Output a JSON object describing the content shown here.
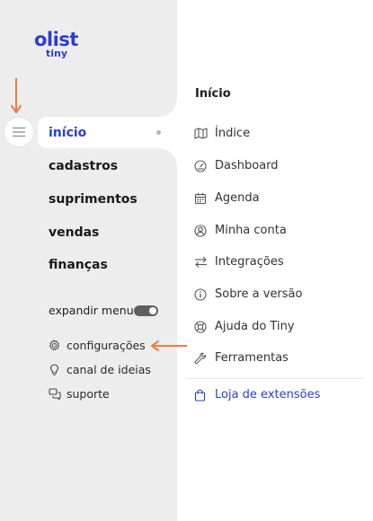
{
  "brand": {
    "name": "olist",
    "sub": "tiny",
    "color": "#2b3ed4"
  },
  "sidebar": {
    "menu_button_icon": "hamburger-icon",
    "items": [
      {
        "label": "início",
        "active": true
      },
      {
        "label": "cadastros"
      },
      {
        "label": "suprimentos"
      },
      {
        "label": "vendas"
      },
      {
        "label": "finanças"
      }
    ],
    "expand_label": "expandir menu",
    "expand_toggle_on": true,
    "utilities": [
      {
        "label": "configurações",
        "icon": "gear-icon"
      },
      {
        "label": "canal de ideias",
        "icon": "lightbulb-icon"
      },
      {
        "label": "suporte",
        "icon": "chat-icon"
      }
    ]
  },
  "panel": {
    "title": "Início",
    "items": [
      {
        "label": "Índice",
        "icon": "map-icon"
      },
      {
        "label": "Dashboard",
        "icon": "gauge-icon"
      },
      {
        "label": "Agenda",
        "icon": "calendar-icon"
      },
      {
        "label": "Minha conta",
        "icon": "user-circle-icon"
      },
      {
        "label": "Integrações",
        "icon": "swap-arrows-icon"
      },
      {
        "label": "Sobre a versão",
        "icon": "info-icon"
      },
      {
        "label": "Ajuda do Tiny",
        "icon": "lifebuoy-icon"
      },
      {
        "label": "Ferramentas",
        "icon": "wrench-icon"
      }
    ],
    "extensions_link": {
      "label": "Loja de extensões",
      "icon": "shopping-bag-icon"
    }
  },
  "annotation_color": "#f07b3f"
}
